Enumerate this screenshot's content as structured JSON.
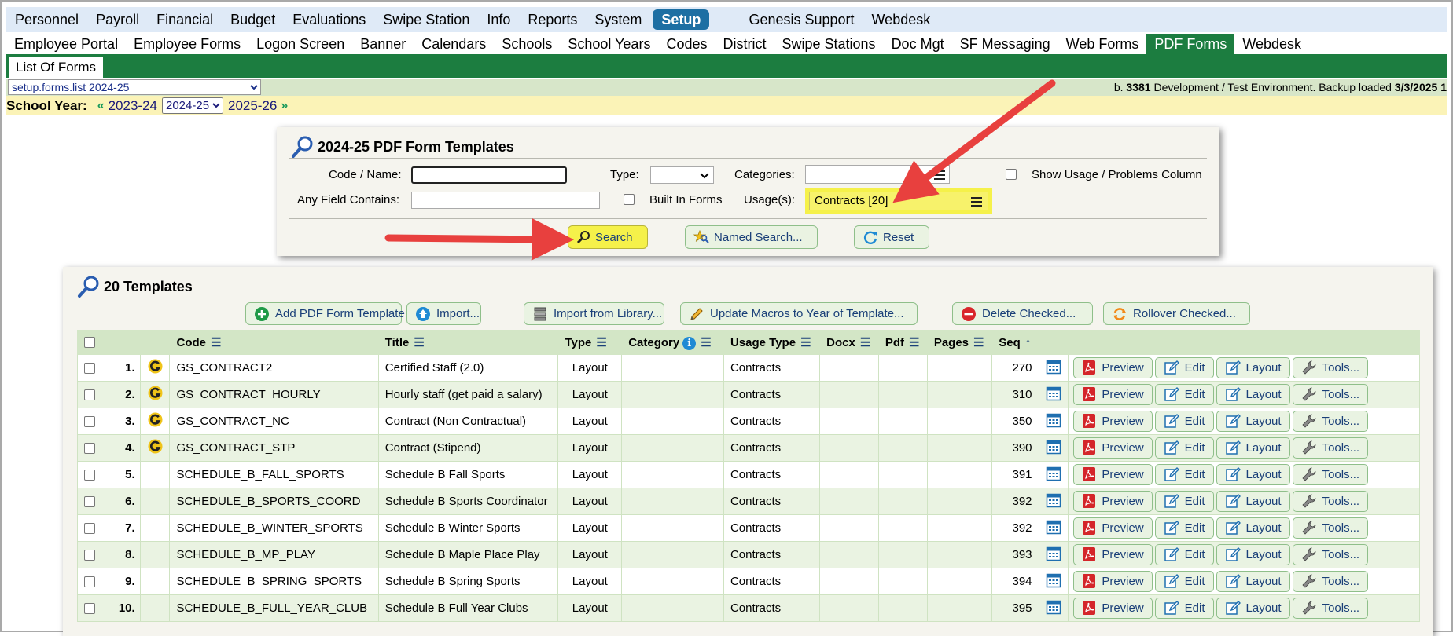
{
  "top_menu": [
    "Personnel",
    "Payroll",
    "Financial",
    "Budget",
    "Evaluations",
    "Swipe Station",
    "Info",
    "Reports",
    "System",
    "Setup",
    "Genesis Support",
    "Webdesk"
  ],
  "top_menu_active": "Setup",
  "sub_menu": [
    "Employee Portal",
    "Employee Forms",
    "Logon Screen",
    "Banner",
    "Calendars",
    "Schools",
    "School Years",
    "Codes",
    "District",
    "Swipe Stations",
    "Doc Mgt",
    "SF Messaging",
    "Web Forms",
    "PDF Forms",
    "Webdesk"
  ],
  "sub_menu_active": "PDF Forms",
  "tab": "List Of Forms",
  "status": {
    "screen_select": "setup.forms.list 2024-25",
    "env_prefix": "b.",
    "build": "3381",
    "env_text": "Development / Test Environment. Backup loaded",
    "backup_date": "3/3/2025 1"
  },
  "year": {
    "label": "School Year:",
    "prev": "2023-24",
    "current": "2024-25",
    "next": "2025-26"
  },
  "search": {
    "title": "2024-25 PDF Form Templates",
    "code_label": "Code / Name:",
    "code_value": "",
    "type_label": "Type:",
    "type_value": "",
    "categories_label": "Categories:",
    "show_usage_label": "Show Usage / Problems Column",
    "any_field_label": "Any Field Contains:",
    "any_field_value": "",
    "built_in_label": "Built In Forms",
    "usage_label": "Usage(s):",
    "usage_value": "Contracts [20]",
    "search_button": "Search",
    "named_search_button": "Named Search...",
    "reset_button": "Reset"
  },
  "templates": {
    "title": "20 Templates",
    "actions": [
      "Add PDF Form Template...",
      "Import...",
      "Import from Library...",
      "Update Macros to Year of Template...",
      "Delete Checked...",
      "Rollover Checked..."
    ],
    "columns": [
      "Code",
      "Title",
      "Type",
      "Category",
      "Usage Type",
      "Docx",
      "Pdf",
      "Pages",
      "Seq"
    ],
    "row_buttons": [
      "Preview",
      "Edit",
      "Layout",
      "Tools..."
    ],
    "rows": [
      {
        "n": "1.",
        "g": true,
        "code": "GS_CONTRACT2",
        "title": "Certified Staff (2.0)",
        "type": "Layout",
        "category": "",
        "usage": "Contracts",
        "docx": "",
        "pdf": "",
        "pages": "",
        "seq": "270"
      },
      {
        "n": "2.",
        "g": true,
        "code": "GS_CONTRACT_HOURLY",
        "title": "Hourly staff (get paid a salary)",
        "type": "Layout",
        "category": "",
        "usage": "Contracts",
        "docx": "",
        "pdf": "",
        "pages": "",
        "seq": "310"
      },
      {
        "n": "3.",
        "g": true,
        "code": "GS_CONTRACT_NC",
        "title": "Contract (Non Contractual)",
        "type": "Layout",
        "category": "",
        "usage": "Contracts",
        "docx": "",
        "pdf": "",
        "pages": "",
        "seq": "350"
      },
      {
        "n": "4.",
        "g": true,
        "code": "GS_CONTRACT_STP",
        "title": "Contract (Stipend)",
        "type": "Layout",
        "category": "",
        "usage": "Contracts",
        "docx": "",
        "pdf": "",
        "pages": "",
        "seq": "390"
      },
      {
        "n": "5.",
        "g": false,
        "code": "SCHEDULE_B_FALL_SPORTS",
        "title": "Schedule B Fall Sports",
        "type": "Layout",
        "category": "",
        "usage": "Contracts",
        "docx": "",
        "pdf": "",
        "pages": "",
        "seq": "391"
      },
      {
        "n": "6.",
        "g": false,
        "code": "SCHEDULE_B_SPORTS_COORD",
        "title": "Schedule B Sports Coordinator",
        "type": "Layout",
        "category": "",
        "usage": "Contracts",
        "docx": "",
        "pdf": "",
        "pages": "",
        "seq": "392"
      },
      {
        "n": "7.",
        "g": false,
        "code": "SCHEDULE_B_WINTER_SPORTS",
        "title": "Schedule B Winter Sports",
        "type": "Layout",
        "category": "",
        "usage": "Contracts",
        "docx": "",
        "pdf": "",
        "pages": "",
        "seq": "392"
      },
      {
        "n": "8.",
        "g": false,
        "code": "SCHEDULE_B_MP_PLAY",
        "title": "Schedule B Maple Place Play",
        "type": "Layout",
        "category": "",
        "usage": "Contracts",
        "docx": "",
        "pdf": "",
        "pages": "",
        "seq": "393"
      },
      {
        "n": "9.",
        "g": false,
        "code": "SCHEDULE_B_SPRING_SPORTS",
        "title": "Schedule B Spring Sports",
        "type": "Layout",
        "category": "",
        "usage": "Contracts",
        "docx": "",
        "pdf": "",
        "pages": "",
        "seq": "394"
      },
      {
        "n": "10.",
        "g": false,
        "code": "SCHEDULE_B_FULL_YEAR_CLUB",
        "title": "Schedule B Full Year Clubs",
        "type": "Layout",
        "category": "",
        "usage": "Contracts",
        "docx": "",
        "pdf": "",
        "pages": "",
        "seq": "395"
      }
    ]
  },
  "colors": {
    "setup_blue": "#1d6fa3",
    "nav_green": "#1c7d40",
    "highlight_yellow": "#f5f14a",
    "arrow_red": "#e8403e"
  }
}
